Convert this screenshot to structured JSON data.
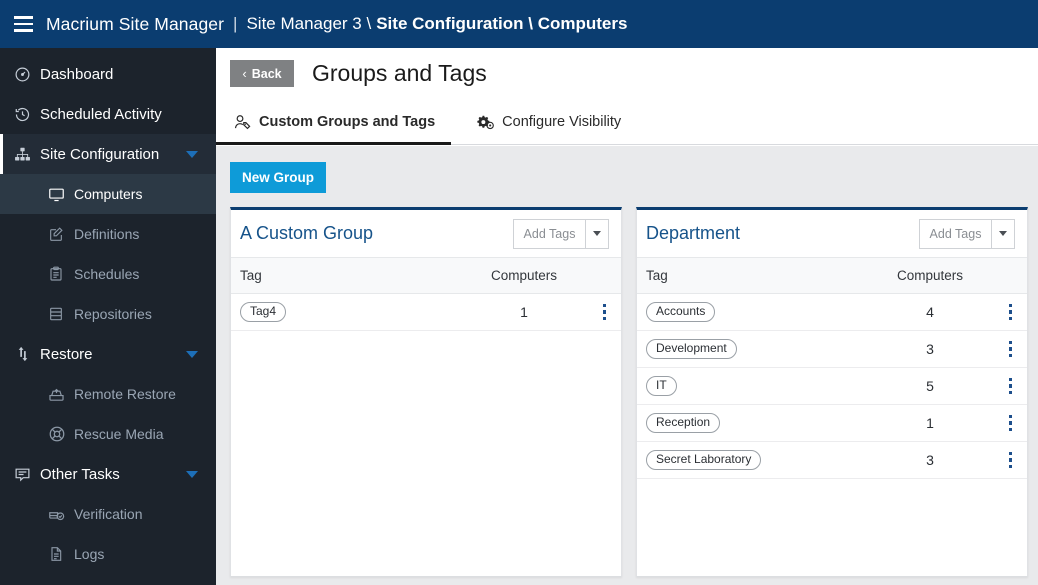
{
  "topbar": {
    "menu_icon": "hamburger-icon",
    "brand": "Macrium Site Manager",
    "separator": "|",
    "breadcrumb_plain": "Site Manager 3 \\",
    "breadcrumb_bold": "Site Configuration \\ Computers"
  },
  "sidebar": {
    "items": [
      {
        "label": "Dashboard",
        "icon": "gauge-icon",
        "level": "top",
        "state": "normal"
      },
      {
        "label": "Scheduled Activity",
        "icon": "clock-history-icon",
        "level": "top",
        "state": "normal"
      },
      {
        "label": "Site Configuration",
        "icon": "sitemap-icon",
        "level": "top",
        "state": "expanded",
        "caret": true
      },
      {
        "label": "Computers",
        "icon": "monitor-icon",
        "level": "sub",
        "state": "selected"
      },
      {
        "label": "Definitions",
        "icon": "edit-square-icon",
        "level": "sub",
        "state": "normal"
      },
      {
        "label": "Schedules",
        "icon": "clipboard-icon",
        "level": "sub",
        "state": "normal"
      },
      {
        "label": "Repositories",
        "icon": "server-icon",
        "level": "sub",
        "state": "normal"
      },
      {
        "label": "Restore",
        "icon": "restore-arrows-icon",
        "level": "top",
        "state": "collapsed",
        "caret": true
      },
      {
        "label": "Remote Restore",
        "icon": "drive-upload-icon",
        "level": "sub",
        "state": "normal"
      },
      {
        "label": "Rescue Media",
        "icon": "lifebuoy-icon",
        "level": "sub",
        "state": "normal"
      },
      {
        "label": "Other Tasks",
        "icon": "message-list-icon",
        "level": "top",
        "state": "collapsed",
        "caret": true
      },
      {
        "label": "Verification",
        "icon": "drive-check-icon",
        "level": "sub",
        "state": "normal"
      },
      {
        "label": "Logs",
        "icon": "document-icon",
        "level": "sub",
        "state": "normal"
      }
    ]
  },
  "page": {
    "back_label": "Back",
    "back_chevron": "‹",
    "title": "Groups and Tags"
  },
  "tabs": [
    {
      "label": "Custom Groups and Tags",
      "icon": "person-tag-icon",
      "active": true
    },
    {
      "label": "Configure Visibility",
      "icon": "gears-icon",
      "active": false
    }
  ],
  "toolbar": {
    "new_group_label": "New Group"
  },
  "table_headers": {
    "tag": "Tag",
    "computers": "Computers"
  },
  "add_tags": {
    "label": "Add Tags",
    "caret_icon": "caret-down-icon"
  },
  "cards": [
    {
      "title": "A Custom Group",
      "rows": [
        {
          "tag": "Tag4",
          "computers": "1"
        }
      ]
    },
    {
      "title": "Department",
      "rows": [
        {
          "tag": "Accounts",
          "computers": "4"
        },
        {
          "tag": "Development",
          "computers": "3"
        },
        {
          "tag": "IT",
          "computers": "5"
        },
        {
          "tag": "Reception",
          "computers": "1"
        },
        {
          "tag": "Secret Laboratory",
          "computers": "3"
        }
      ]
    }
  ],
  "colors": {
    "topbar": "#0b3d70",
    "sidebar": "#1c232c",
    "accent_blue": "#0e9bd8",
    "card_title": "#16538a",
    "panel_bg": "#e9eaec",
    "kebab": "#1d4f8c"
  }
}
